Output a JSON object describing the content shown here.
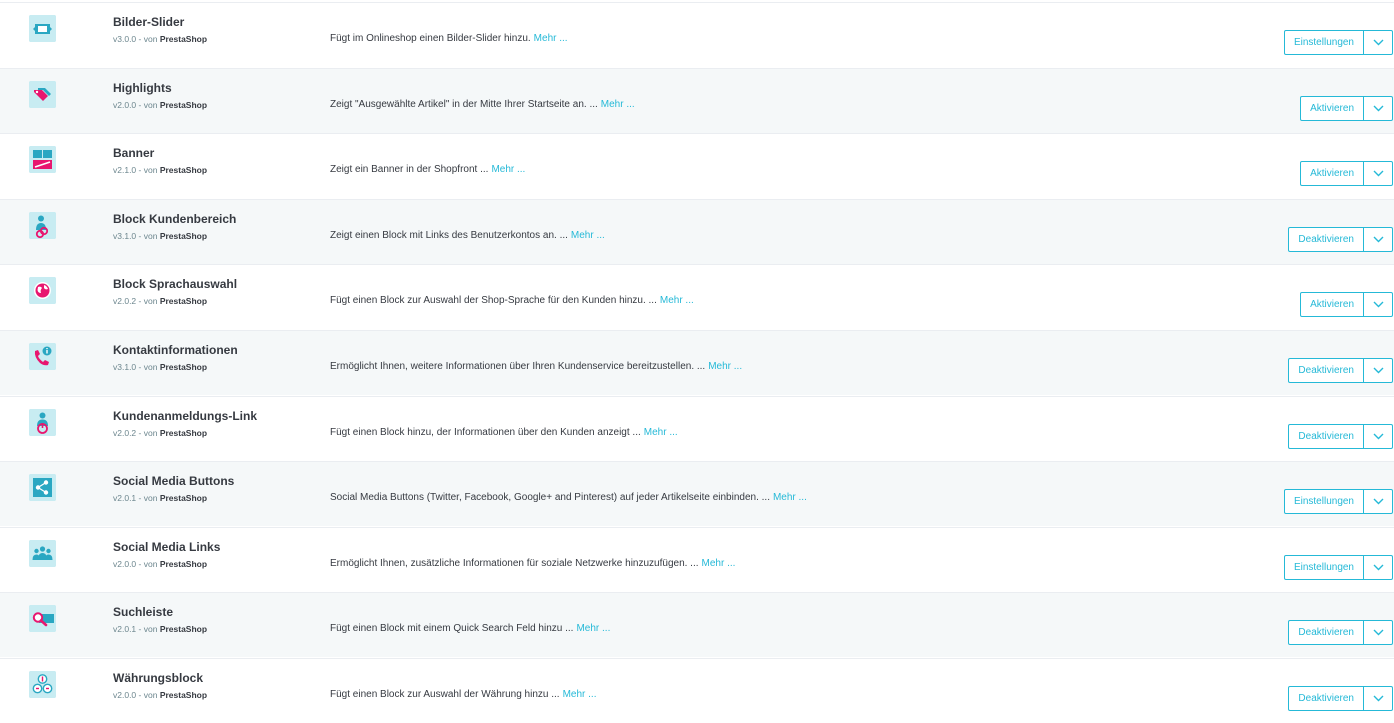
{
  "colors": {
    "accent": "#25b9d7",
    "icon_bg": "#c8ecf2",
    "icon_magenta": "#e8166f"
  },
  "modules": [
    {
      "name": "Bilder-Slider",
      "version": "v3.0.0",
      "by": "- von",
      "author": "PrestaShop",
      "description": "Fügt im Onlineshop einen Bilder-Slider hinzu.",
      "more": "Mehr ...",
      "action": "Einstellungen",
      "icon": "image-slider-icon"
    },
    {
      "name": "Highlights",
      "version": "v2.0.0",
      "by": "- von",
      "author": "PrestaShop",
      "description": "Zeigt \"Ausgewählte Artikel\" in der Mitte Ihrer Startseite an. ...",
      "more": "Mehr ...",
      "action": "Aktivieren",
      "icon": "tags-icon"
    },
    {
      "name": "Banner",
      "version": "v2.1.0",
      "by": "- von",
      "author": "PrestaShop",
      "description": "Zeigt ein Banner in der Shopfront ...",
      "more": "Mehr ...",
      "action": "Aktivieren",
      "icon": "banner-icon"
    },
    {
      "name": "Block Kundenbereich",
      "version": "v3.1.0",
      "by": "- von",
      "author": "PrestaShop",
      "description": "Zeigt einen Block mit Links des Benutzerkontos an. ...",
      "more": "Mehr ...",
      "action": "Deaktivieren",
      "icon": "user-link-icon"
    },
    {
      "name": "Block Sprachauswahl",
      "version": "v2.0.2",
      "by": "- von",
      "author": "PrestaShop",
      "description": "Fügt einen Block zur Auswahl der Shop-Sprache für den Kunden hinzu. ...",
      "more": "Mehr ...",
      "action": "Aktivieren",
      "icon": "globe-icon"
    },
    {
      "name": "Kontaktinformationen",
      "version": "v3.1.0",
      "by": "- von",
      "author": "PrestaShop",
      "description": "Ermöglicht Ihnen, weitere Informationen über Ihren Kundenservice bereitzustellen. ...",
      "more": "Mehr ...",
      "action": "Deaktivieren",
      "icon": "phone-info-icon"
    },
    {
      "name": "Kundenanmeldungs-Link",
      "version": "v2.0.2",
      "by": "- von",
      "author": "PrestaShop",
      "description": "Fügt einen Block hinzu, der Informationen über den Kunden anzeigt ...",
      "more": "Mehr ...",
      "action": "Deaktivieren",
      "icon": "user-power-icon"
    },
    {
      "name": "Social Media Buttons",
      "version": "v2.0.1",
      "by": "- von",
      "author": "PrestaShop",
      "description": "Social Media Buttons (Twitter, Facebook, Google+ and Pinterest) auf jeder Artikelseite einbinden. ...",
      "more": "Mehr ...",
      "action": "Einstellungen",
      "icon": "share-icon"
    },
    {
      "name": "Social Media Links",
      "version": "v2.0.0",
      "by": "- von",
      "author": "PrestaShop",
      "description": "Ermöglicht Ihnen, zusätzliche Informationen für soziale Netzwerke hinzuzufügen. ...",
      "more": "Mehr ...",
      "action": "Einstellungen",
      "icon": "people-icon"
    },
    {
      "name": "Suchleiste",
      "version": "v2.0.1",
      "by": "- von",
      "author": "PrestaShop",
      "description": "Fügt einen Block mit einem Quick Search Feld hinzu ...",
      "more": "Mehr ...",
      "action": "Deaktivieren",
      "icon": "search-bar-icon"
    },
    {
      "name": "Währungsblock",
      "version": "v2.0.0",
      "by": "- von",
      "author": "PrestaShop",
      "description": "Fügt einen Block zur Auswahl der Währung hinzu ...",
      "more": "Mehr ...",
      "action": "Deaktivieren",
      "icon": "currency-icon"
    }
  ]
}
